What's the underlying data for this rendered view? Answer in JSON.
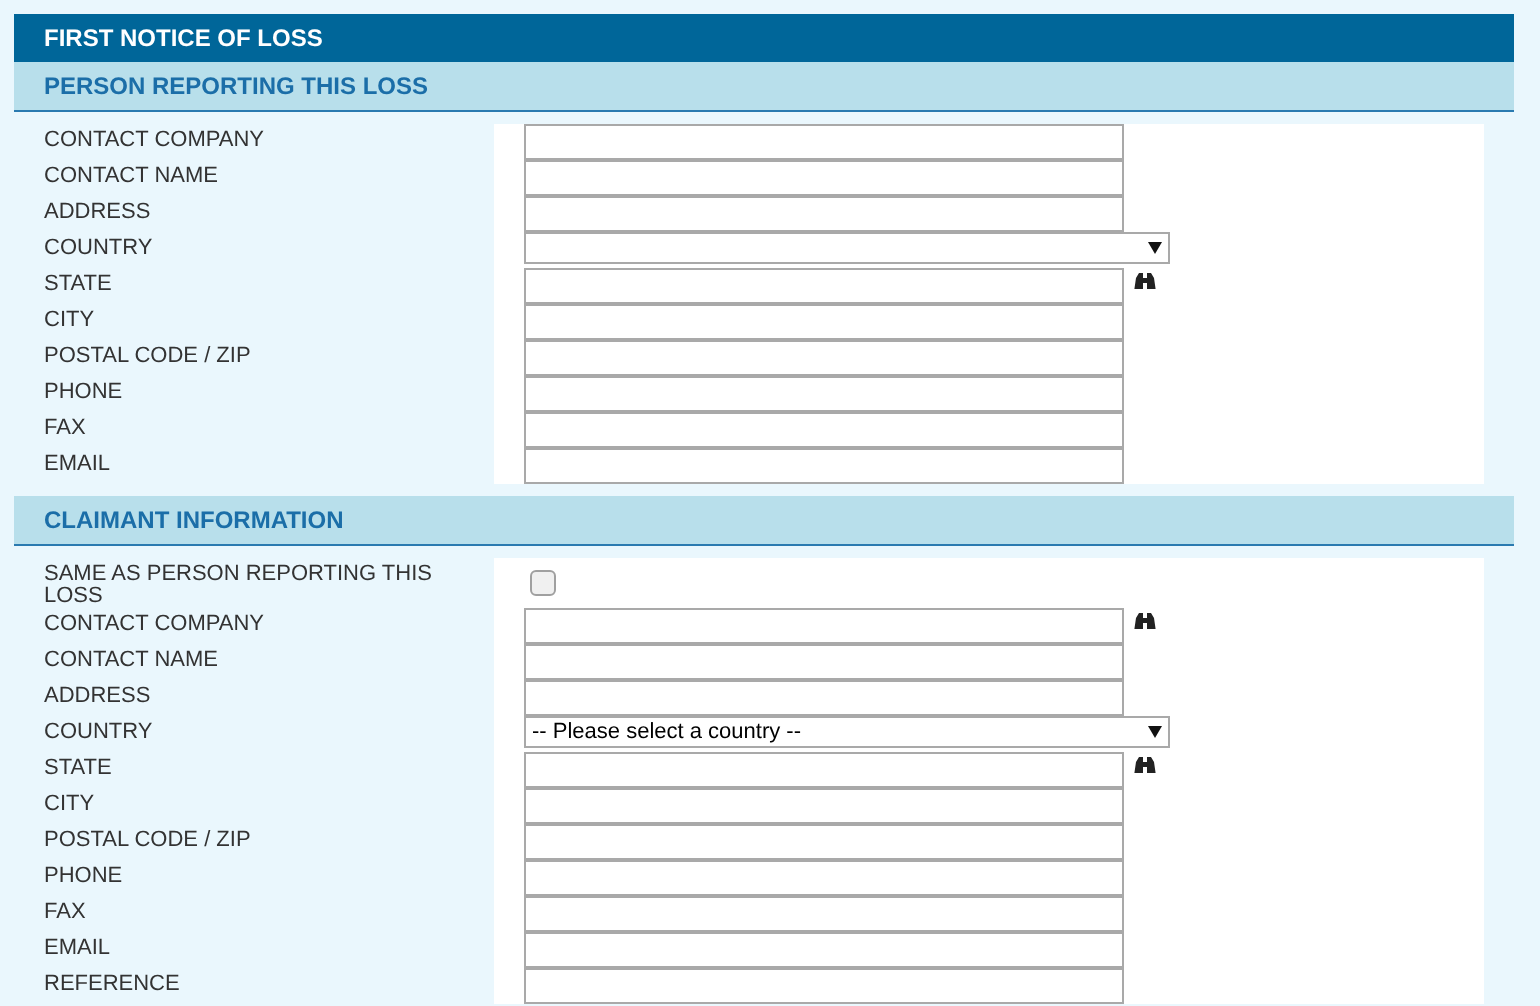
{
  "form": {
    "title": "FIRST NOTICE OF LOSS",
    "sections": [
      {
        "title": "PERSON REPORTING THIS LOSS",
        "fields": [
          {
            "label": "CONTACT COMPANY",
            "kind": "text",
            "lookup": false
          },
          {
            "label": "CONTACT NAME",
            "kind": "text",
            "lookup": false
          },
          {
            "label": "ADDRESS",
            "kind": "text",
            "lookup": false
          },
          {
            "label": "COUNTRY",
            "kind": "select"
          },
          {
            "label": "STATE",
            "kind": "text",
            "lookup": true
          },
          {
            "label": "CITY",
            "kind": "text",
            "lookup": false
          },
          {
            "label": "POSTAL CODE / ZIP",
            "kind": "text",
            "lookup": false
          },
          {
            "label": "PHONE",
            "kind": "text",
            "lookup": false
          },
          {
            "label": "FAX",
            "kind": "text",
            "lookup": false
          },
          {
            "label": "EMAIL",
            "kind": "text",
            "lookup": false
          }
        ]
      },
      {
        "title": "CLAIMANT INFORMATION",
        "fields": [
          {
            "label": "SAME AS PERSON REPORTING THIS LOSS",
            "kind": "checkbox",
            "checked": false
          },
          {
            "label": "CONTACT COMPANY",
            "kind": "text",
            "lookup": true
          },
          {
            "label": "CONTACT NAME",
            "kind": "text",
            "lookup": false
          },
          {
            "label": "ADDRESS",
            "kind": "text",
            "lookup": false
          },
          {
            "label": "COUNTRY",
            "kind": "select",
            "value": "-- Please select a country --"
          },
          {
            "label": "STATE",
            "kind": "text",
            "lookup": true
          },
          {
            "label": "CITY",
            "kind": "text",
            "lookup": false
          },
          {
            "label": "POSTAL CODE / ZIP",
            "kind": "text",
            "lookup": false
          },
          {
            "label": "PHONE",
            "kind": "text",
            "lookup": false
          },
          {
            "label": "FAX",
            "kind": "text",
            "lookup": false
          },
          {
            "label": "EMAIL",
            "kind": "text",
            "lookup": false
          },
          {
            "label": "REFERENCE",
            "kind": "text",
            "lookup": false
          }
        ]
      }
    ]
  }
}
